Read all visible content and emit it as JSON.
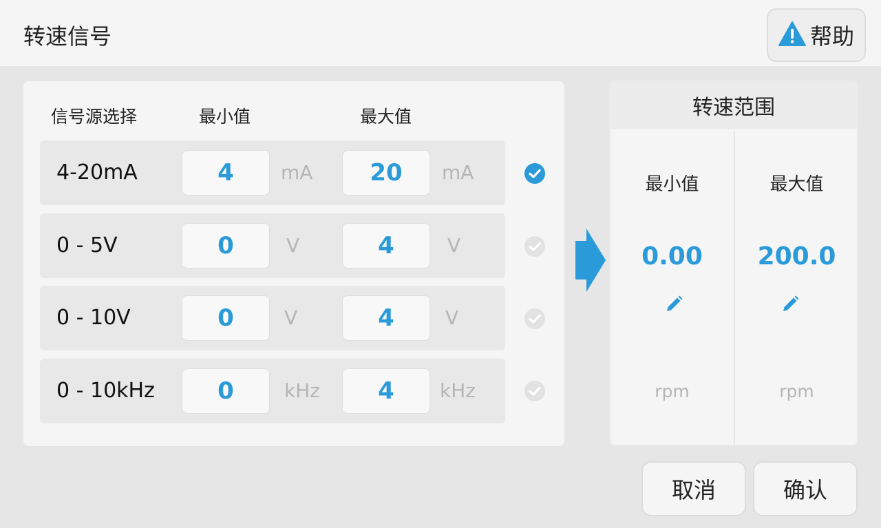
{
  "header": {
    "title": "转速信号",
    "help_label": "帮助"
  },
  "signal_table": {
    "headers": {
      "source": "信号源选择",
      "min": "最小值",
      "max": "最大值"
    },
    "rows": [
      {
        "name": "4-20mA",
        "min": "4",
        "min_unit": "mA",
        "max": "20",
        "max_unit": "mA",
        "selected": true
      },
      {
        "name": "0 - 5V",
        "min": "0",
        "min_unit": "V",
        "max": "4",
        "max_unit": "V",
        "selected": false
      },
      {
        "name": "0 - 10V",
        "min": "0",
        "min_unit": "V",
        "max": "4",
        "max_unit": "V",
        "selected": false
      },
      {
        "name": "0 - 10kHz",
        "min": "0",
        "min_unit": "kHz",
        "max": "4",
        "max_unit": "kHz",
        "selected": false
      }
    ]
  },
  "speed_range": {
    "title": "转速范围",
    "min": {
      "label": "最小值",
      "value": "0.00",
      "unit": "rpm"
    },
    "max": {
      "label": "最大值",
      "value": "200.0",
      "unit": "rpm"
    }
  },
  "actions": {
    "cancel": "取消",
    "confirm": "确认"
  },
  "colors": {
    "accent": "#2a9bd8",
    "check_inactive": "#e2e2e2",
    "unit_text": "#b5b5b5"
  },
  "icons": {
    "help": "warning-icon",
    "check": "check-circle-icon",
    "arrow": "arrow-right-icon",
    "edit": "pencil-icon"
  }
}
